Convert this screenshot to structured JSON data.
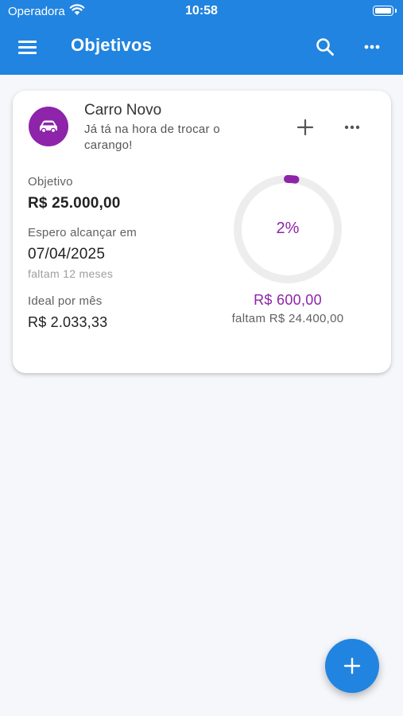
{
  "status_bar": {
    "carrier": "Operadora",
    "time": "10:58"
  },
  "app_bar": {
    "title": "Objetivos"
  },
  "goal": {
    "name": "Carro Novo",
    "description": "Já tá na hora de trocar o carango!",
    "objective_label": "Objetivo",
    "objective_value": "R$ 25.000,00",
    "target_label": "Espero alcançar em",
    "target_date": "07/04/2025",
    "time_left": "faltam 12 meses",
    "monthly_label": "Ideal por mês",
    "monthly_value": "R$ 2.033,33",
    "progress_percent": "2%",
    "progress_fraction": 0.024,
    "saved_amount": "R$ 600,00",
    "remaining_amount": "faltam R$ 24.400,00"
  },
  "icons": {
    "menu": "menu-icon",
    "search": "search-icon",
    "more": "more-horizontal-icon",
    "goal": "car-icon",
    "add": "plus-icon",
    "fab": "plus-icon"
  },
  "colors": {
    "primary": "#2184e0",
    "accent": "#8e24aa",
    "ring_track": "#ededed",
    "background": "#f5f7fb"
  }
}
